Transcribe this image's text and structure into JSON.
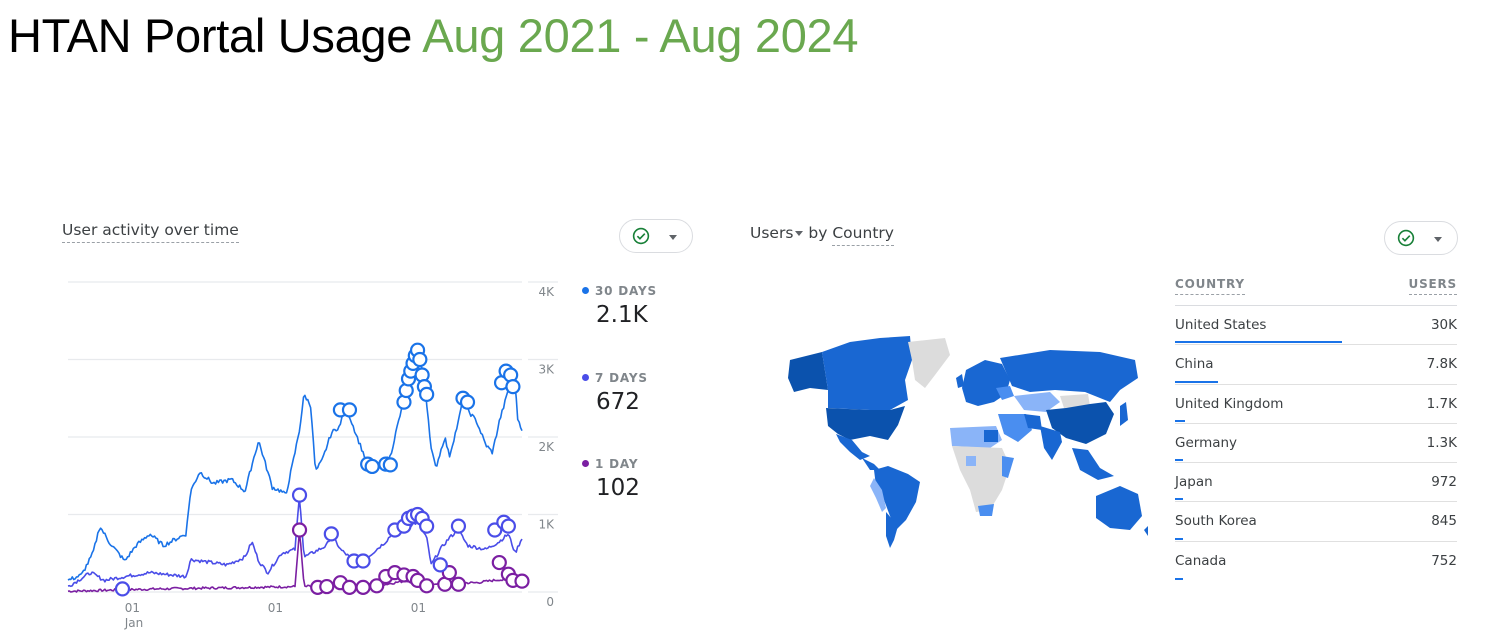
{
  "page": {
    "title_main": "HTAN Portal Usage",
    "title_range": "Aug 2021 - Aug 2024",
    "range_color": "#6aa84f"
  },
  "activity_card": {
    "title": "User activity over time",
    "status_icon": "check-circle-icon",
    "status_color": "#188038",
    "menu_icon": "caret-down-icon",
    "legend": [
      {
        "label": "30 DAYS",
        "value": "2.1K",
        "color": "#1a73e8"
      },
      {
        "label": "7 DAYS",
        "value": "672",
        "color": "#4a4de8"
      },
      {
        "label": "1 DAY",
        "value": "102",
        "color": "#7b1fa2"
      }
    ]
  },
  "country_card": {
    "title_metric": "Users",
    "title_connector": "by",
    "title_dimension": "Country",
    "status_icon": "check-circle-icon",
    "menu_icon": "caret-down-icon",
    "table": {
      "headers": [
        "COUNTRY",
        "USERS"
      ],
      "rows": [
        {
          "country": "United States",
          "users": "30K",
          "share": 1.0
        },
        {
          "country": "China",
          "users": "7.8K",
          "share": 0.26
        },
        {
          "country": "United Kingdom",
          "users": "1.7K",
          "share": 0.057
        },
        {
          "country": "Germany",
          "users": "1.3K",
          "share": 0.043
        },
        {
          "country": "Japan",
          "users": "972",
          "share": 0.032
        },
        {
          "country": "South Korea",
          "users": "845",
          "share": 0.028
        },
        {
          "country": "Canada",
          "users": "752",
          "share": 0.025
        }
      ]
    },
    "map": {
      "type": "choropleth",
      "darkest": [
        "United States",
        "China",
        "Alaska"
      ],
      "colors": {
        "dark": "#0b52ad",
        "mid": "#1967d2",
        "light": "#4a8ef0",
        "lighter": "#8ab4f8",
        "none": "#dcdcdc"
      }
    }
  },
  "chart_data": {
    "type": "line",
    "title": "User activity over time",
    "xlabel": "",
    "ylabel": "",
    "x_ticks": [
      {
        "label": "01",
        "sublabel": "Jan",
        "t": 0.125
      },
      {
        "label": "01",
        "sublabel": "",
        "t": 0.44
      },
      {
        "label": "01",
        "sublabel": "",
        "t": 0.755
      }
    ],
    "y_ticks": [
      "0",
      "1K",
      "2K",
      "3K",
      "4K"
    ],
    "ylim": [
      0,
      4000
    ],
    "grid": true,
    "legend_position": "right",
    "x_domain": "Aug 2021 - Aug 2024 (normalized 0-1)",
    "series": [
      {
        "name": "30 DAYS",
        "color": "#1a73e8",
        "points": [
          [
            0,
            150
          ],
          [
            0.03,
            220
          ],
          [
            0.055,
            500
          ],
          [
            0.07,
            850
          ],
          [
            0.09,
            650
          ],
          [
            0.125,
            400
          ],
          [
            0.15,
            600
          ],
          [
            0.18,
            750
          ],
          [
            0.21,
            600
          ],
          [
            0.26,
            750
          ],
          [
            0.27,
            1300
          ],
          [
            0.29,
            1550
          ],
          [
            0.32,
            1400
          ],
          [
            0.36,
            1450
          ],
          [
            0.39,
            1300
          ],
          [
            0.41,
            1750
          ],
          [
            0.42,
            1950
          ],
          [
            0.435,
            1650
          ],
          [
            0.45,
            1350
          ],
          [
            0.47,
            1300
          ],
          [
            0.48,
            1250
          ],
          [
            0.5,
            1800
          ],
          [
            0.51,
            2100
          ],
          [
            0.52,
            2550
          ],
          [
            0.535,
            2400
          ],
          [
            0.545,
            1550
          ],
          [
            0.56,
            1700
          ],
          [
            0.58,
            2050
          ],
          [
            0.6,
            2150
          ],
          [
            0.605,
            2300
          ],
          [
            0.615,
            2350
          ],
          [
            0.64,
            1950
          ],
          [
            0.66,
            1650
          ],
          [
            0.68,
            1600
          ],
          [
            0.71,
            1750
          ],
          [
            0.73,
            2250
          ],
          [
            0.75,
            2650
          ],
          [
            0.76,
            2950
          ],
          [
            0.77,
            3100
          ],
          [
            0.785,
            2750
          ],
          [
            0.8,
            1850
          ],
          [
            0.81,
            1600
          ],
          [
            0.83,
            2000
          ],
          [
            0.84,
            1750
          ],
          [
            0.86,
            2200
          ],
          [
            0.87,
            2500
          ],
          [
            0.88,
            2350
          ],
          [
            0.9,
            2200
          ],
          [
            0.92,
            1900
          ],
          [
            0.935,
            1800
          ],
          [
            0.95,
            2200
          ],
          [
            0.965,
            2500
          ],
          [
            0.975,
            2750
          ],
          [
            0.985,
            2700
          ],
          [
            0.99,
            2250
          ],
          [
            1.0,
            2100
          ]
        ]
      },
      {
        "name": "7 DAYS",
        "color": "#4a4de8",
        "points": [
          [
            0,
            70
          ],
          [
            0.05,
            250
          ],
          [
            0.08,
            150
          ],
          [
            0.125,
            200
          ],
          [
            0.18,
            250
          ],
          [
            0.26,
            200
          ],
          [
            0.27,
            420
          ],
          [
            0.35,
            350
          ],
          [
            0.39,
            450
          ],
          [
            0.405,
            650
          ],
          [
            0.42,
            400
          ],
          [
            0.44,
            250
          ],
          [
            0.47,
            500
          ],
          [
            0.5,
            550
          ],
          [
            0.51,
            1250
          ],
          [
            0.52,
            450
          ],
          [
            0.57,
            600
          ],
          [
            0.58,
            750
          ],
          [
            0.6,
            550
          ],
          [
            0.63,
            400
          ],
          [
            0.66,
            450
          ],
          [
            0.7,
            650
          ],
          [
            0.72,
            800
          ],
          [
            0.75,
            850
          ],
          [
            0.77,
            900
          ],
          [
            0.79,
            700
          ],
          [
            0.8,
            350
          ],
          [
            0.82,
            550
          ],
          [
            0.84,
            700
          ],
          [
            0.86,
            800
          ],
          [
            0.88,
            600
          ],
          [
            0.92,
            550
          ],
          [
            0.95,
            650
          ],
          [
            0.97,
            750
          ],
          [
            0.985,
            500
          ],
          [
            1.0,
            700
          ]
        ]
      },
      {
        "name": "1 DAY",
        "color": "#7b1fa2",
        "points": [
          [
            0,
            10
          ],
          [
            0.1,
            25
          ],
          [
            0.2,
            40
          ],
          [
            0.3,
            50
          ],
          [
            0.4,
            60
          ],
          [
            0.5,
            70
          ],
          [
            0.51,
            800
          ],
          [
            0.52,
            70
          ],
          [
            0.6,
            90
          ],
          [
            0.7,
            100
          ],
          [
            0.75,
            150
          ],
          [
            0.8,
            110
          ],
          [
            0.9,
            120
          ],
          [
            0.95,
            160
          ],
          [
            1.0,
            102
          ]
        ]
      }
    ],
    "annotations": {
      "30 DAYS": [
        [
          0.6,
          2350
        ],
        [
          0.62,
          2350
        ],
        [
          0.66,
          1650
        ],
        [
          0.67,
          1620
        ],
        [
          0.7,
          1650
        ],
        [
          0.71,
          1640
        ],
        [
          0.74,
          2450
        ],
        [
          0.745,
          2600
        ],
        [
          0.75,
          2750
        ],
        [
          0.755,
          2850
        ],
        [
          0.76,
          2950
        ],
        [
          0.765,
          3050
        ],
        [
          0.77,
          3120
        ],
        [
          0.775,
          3000
        ],
        [
          0.78,
          2800
        ],
        [
          0.785,
          2650
        ],
        [
          0.79,
          2550
        ],
        [
          0.87,
          2500
        ],
        [
          0.88,
          2450
        ],
        [
          0.955,
          2700
        ],
        [
          0.965,
          2850
        ],
        [
          0.975,
          2800
        ],
        [
          0.98,
          2650
        ]
      ],
      "7 DAYS": [
        [
          0.12,
          40
        ],
        [
          0.51,
          1250
        ],
        [
          0.58,
          750
        ],
        [
          0.63,
          400
        ],
        [
          0.65,
          400
        ],
        [
          0.72,
          800
        ],
        [
          0.74,
          850
        ],
        [
          0.75,
          950
        ],
        [
          0.76,
          980
        ],
        [
          0.77,
          1000
        ],
        [
          0.78,
          950
        ],
        [
          0.79,
          850
        ],
        [
          0.82,
          350
        ],
        [
          0.86,
          850
        ],
        [
          0.94,
          800
        ],
        [
          0.96,
          900
        ],
        [
          0.97,
          850
        ]
      ],
      "1 DAY": [
        [
          0.51,
          800
        ],
        [
          0.55,
          60
        ],
        [
          0.57,
          70
        ],
        [
          0.6,
          120
        ],
        [
          0.62,
          60
        ],
        [
          0.65,
          60
        ],
        [
          0.68,
          80
        ],
        [
          0.7,
          200
        ],
        [
          0.72,
          250
        ],
        [
          0.74,
          220
        ],
        [
          0.76,
          200
        ],
        [
          0.77,
          150
        ],
        [
          0.79,
          80
        ],
        [
          0.83,
          100
        ],
        [
          0.84,
          250
        ],
        [
          0.86,
          100
        ],
        [
          0.95,
          380
        ],
        [
          0.97,
          230
        ],
        [
          0.98,
          150
        ],
        [
          1.0,
          140
        ]
      ]
    }
  }
}
